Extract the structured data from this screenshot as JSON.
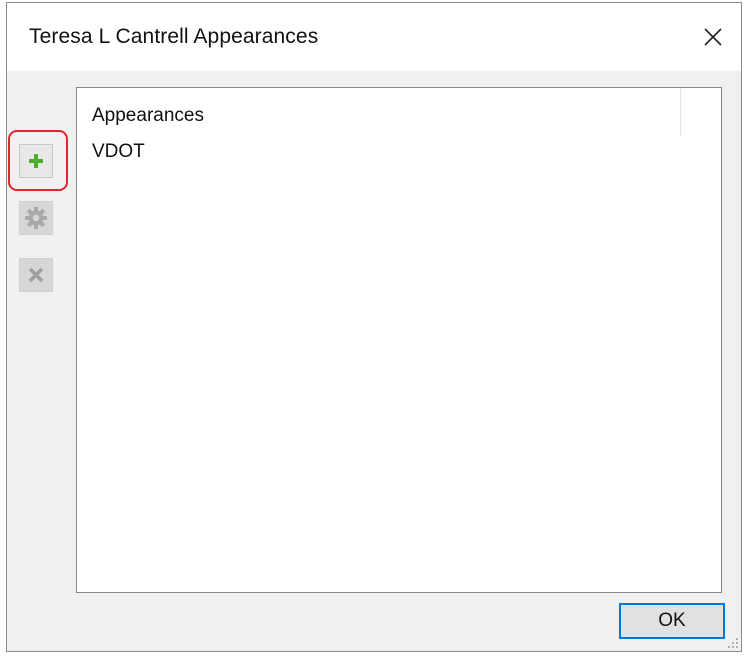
{
  "window": {
    "title": "Teresa L Cantrell Appearances",
    "close_icon": "close-icon"
  },
  "toolbar": {
    "add_icon": "plus-icon",
    "settings_icon": "gear-icon",
    "remove_icon": "x-icon",
    "add_color": "#4caf2a",
    "disabled_color": "#9e9e9e",
    "highlight_color": "#e0262b"
  },
  "list": {
    "header": "Appearances",
    "items": [
      {
        "label": "VDOT"
      }
    ]
  },
  "footer": {
    "ok_label": "OK",
    "accent_color": "#0078d7"
  }
}
